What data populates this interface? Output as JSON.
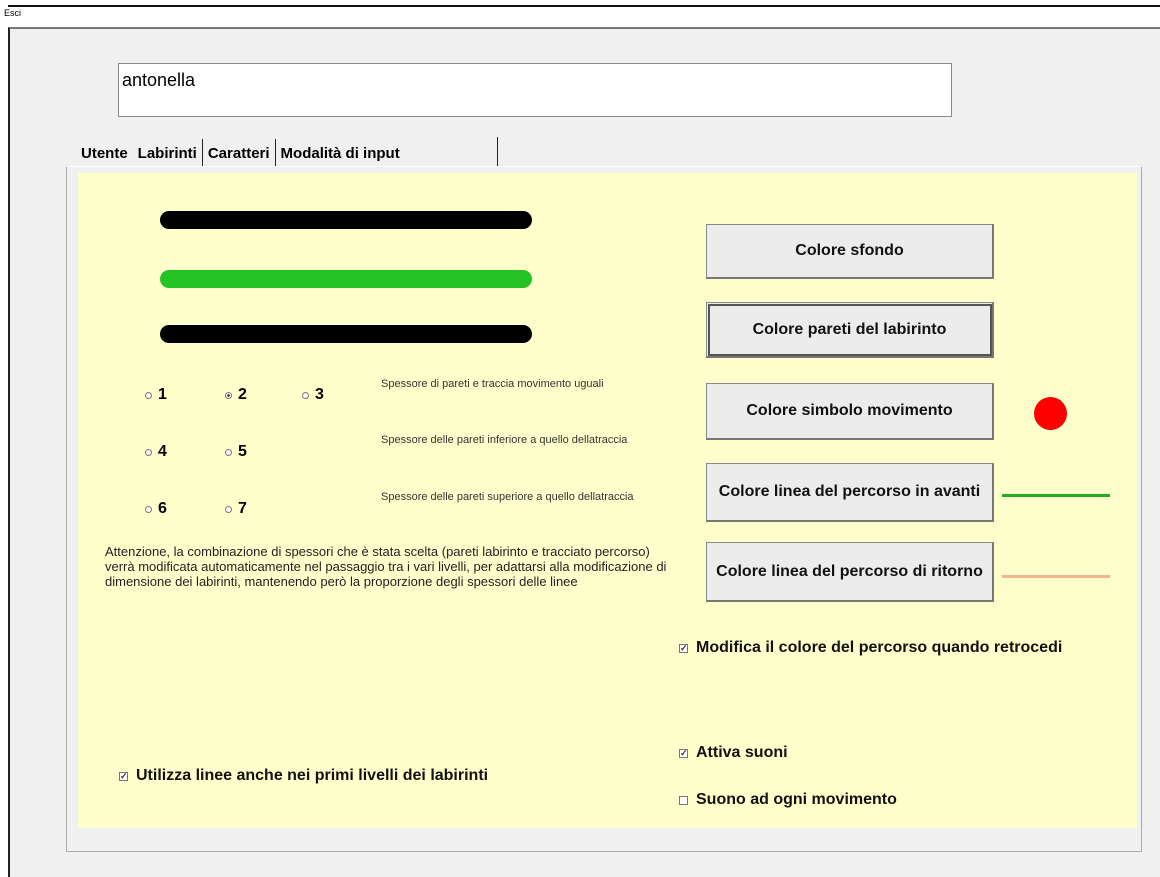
{
  "toolbar": {
    "exit_label": "Esci"
  },
  "user": {
    "name": "antonella"
  },
  "tabs": [
    {
      "label": "Utente"
    },
    {
      "label": "Labirinti"
    },
    {
      "label": "Caratteri"
    },
    {
      "label": "Modalità di input"
    }
  ],
  "active_tab": "Labirinti",
  "preview_lines": [
    {
      "color": "#000000"
    },
    {
      "color": "#22c322"
    },
    {
      "color": "#000000"
    }
  ],
  "thickness": {
    "options": [
      "1",
      "2",
      "3",
      "4",
      "5",
      "6",
      "7"
    ],
    "selected": "2",
    "descriptions": [
      "Spessore di pareti e traccia movimento uguali",
      "Spessore delle pareti inferiore a quello dellatraccia",
      "Spessore delle pareti superiore a quello dellatraccia"
    ]
  },
  "warning": "Attenzione, la combinazione di spessori che è stata scelta (pareti labirinto e tracciato percorso) verrà modificata automaticamente nel passaggio tra i vari livelli, per adattarsi alla modificazione di dimensione dei labirinti, mantenendo però la proporzione degli spessori delle linee",
  "buttons": {
    "background": "Colore sfondo",
    "walls": "Colore pareti del labirinto",
    "symbol": "Colore simbolo movimento",
    "forward": "Colore linea del percorso in avanti",
    "back": "Colore linea del percorso di ritorno"
  },
  "colors": {
    "symbol": "#ff0000",
    "forward_line": "#22b022",
    "back_line": "#f0b890",
    "panel": "#ffffcc"
  },
  "checks": {
    "use_lines": {
      "label": "Utilizza linee anche nei primi livelli dei labirinti",
      "checked": true
    },
    "change_color": {
      "label": "Modifica il colore del percorso quando retrocedi",
      "checked": true
    },
    "sounds": {
      "label": "Attiva suoni",
      "checked": true
    },
    "move_sound": {
      "label": "Suono ad ogni movimento",
      "checked": false
    }
  }
}
